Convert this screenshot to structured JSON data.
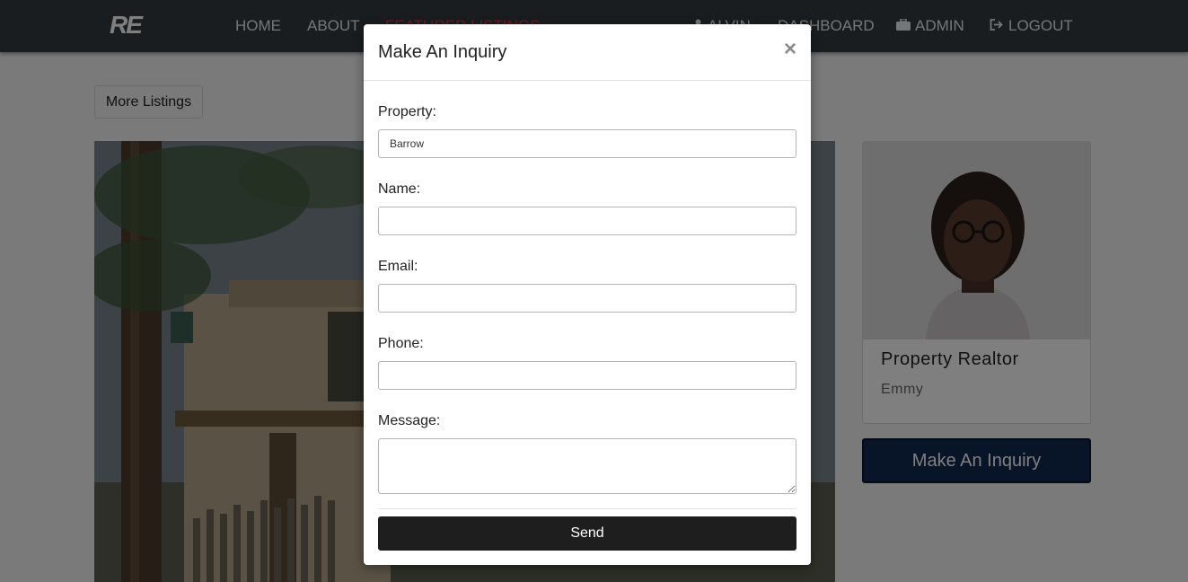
{
  "brand": {
    "logo": "RE"
  },
  "nav": {
    "home": "HOME",
    "about": "ABOUT",
    "featured": "FEATURED LISTINGS",
    "user": "ALVIN",
    "dashboard": "DASHBOARD",
    "admin": "ADMIN",
    "logout": "LOGOUT"
  },
  "page": {
    "more_listings": "More Listings",
    "realtor": {
      "title": "Property Realtor",
      "name": "Emmy"
    },
    "inquiry_button": "Make An Inquiry"
  },
  "modal": {
    "title": "Make An Inquiry",
    "close": "×",
    "fields": {
      "property_label": "Property:",
      "property_value": "Barrow",
      "name_label": "Name:",
      "name_value": "",
      "email_label": "Email:",
      "email_value": "",
      "phone_label": "Phone:",
      "phone_value": "",
      "message_label": "Message:",
      "message_value": ""
    },
    "send": "Send"
  },
  "icons": {
    "user": "user-icon",
    "admin": "briefcase-icon",
    "logout": "sign-out-icon"
  },
  "colors": {
    "navbar": "#343a40",
    "active_link": "#ef2f38",
    "inquiry_button": "#10284e",
    "send_button": "#1e1e1e"
  }
}
